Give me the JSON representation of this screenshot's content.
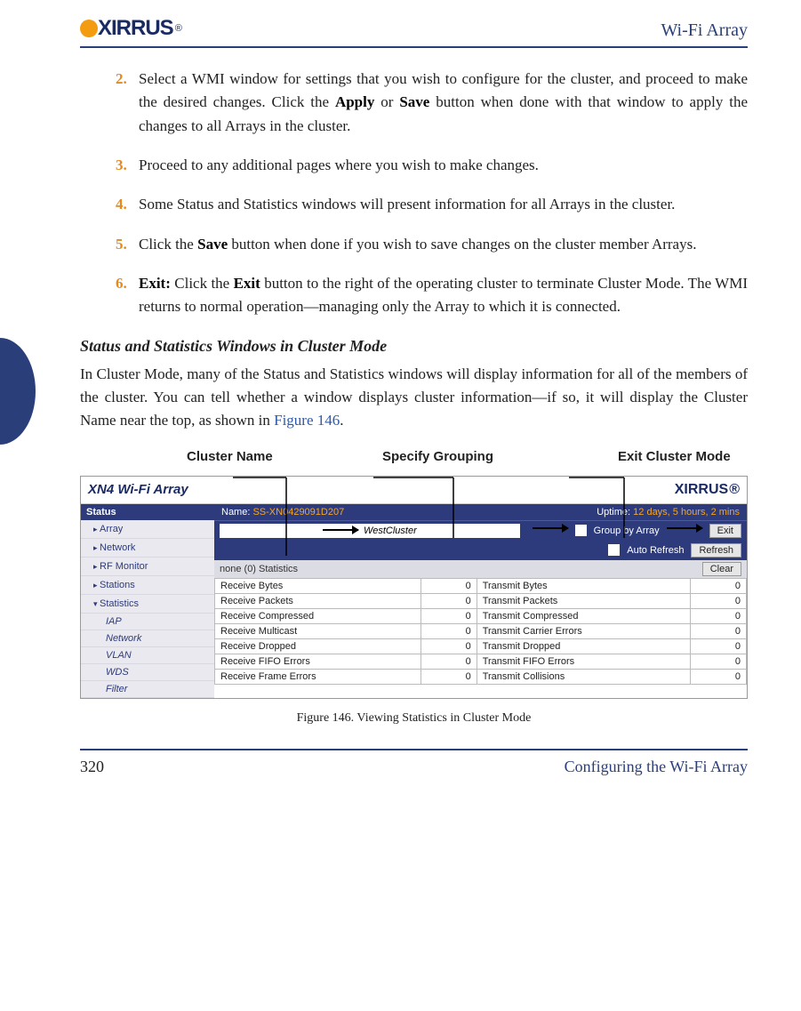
{
  "header": {
    "logo_text": "XIRRUS",
    "title": "Wi-Fi Array"
  },
  "steps": [
    {
      "num": "2.",
      "html": "Select a WMI window for settings that you wish to configure for the cluster, and proceed to make the desired changes. Click the <b>Apply</b> or <b>Save</b> button when done with that window to apply the changes to all Arrays in the cluster."
    },
    {
      "num": "3.",
      "html": "Proceed to any additional pages where you wish to make changes."
    },
    {
      "num": "4.",
      "html": "Some Status and Statistics windows will present information for all Arrays in the cluster."
    },
    {
      "num": "5.",
      "html": "Click the <b>Save</b> button when done if you wish to save changes on the cluster member Arrays."
    },
    {
      "num": "6.",
      "html": "<b>Exit:</b> Click the <b>Exit</b> button to the right of the operating cluster to terminate Cluster Mode. The WMI returns to normal operation—managing only the Array to which it is connected."
    }
  ],
  "subhead": "Status and Statistics Windows in Cluster Mode",
  "para": "In Cluster Mode, many of the Status and Statistics windows will display information for all of the members of the cluster. You can tell whether a window displays cluster information—if so, it will display the Cluster Name near the top, as shown in ",
  "figref": "Figure 146",
  "para_end": ".",
  "callouts": {
    "c1": "Cluster Name",
    "c2": "Specify Grouping",
    "c3": "Exit Cluster Mode"
  },
  "shot": {
    "title": "XN4 Wi-Fi Array",
    "logo": "XIRRUS",
    "name_label": "Name:",
    "name_value": "SS-XN0429091D207",
    "uptime_label": "Uptime:",
    "uptime_value": "12 days, 5 hours, 2 mins",
    "cluster_name": "WestCluster",
    "group_label": "Group by Array",
    "exit_btn": "Exit",
    "auto_refresh": "Auto Refresh",
    "refresh_btn": "Refresh",
    "clear_btn": "Clear",
    "stats_title": "none (0) Statistics",
    "sidebar": {
      "head": "Status",
      "items": [
        "Array",
        "Network",
        "RF Monitor",
        "Stations"
      ],
      "expanded": "Statistics",
      "subs": [
        "IAP",
        "Network",
        "VLAN",
        "WDS",
        "Filter"
      ]
    },
    "rows": [
      [
        "Receive Bytes",
        "0",
        "Transmit Bytes",
        "0"
      ],
      [
        "Receive Packets",
        "0",
        "Transmit Packets",
        "0"
      ],
      [
        "Receive Compressed",
        "0",
        "Transmit Compressed",
        "0"
      ],
      [
        "Receive Multicast",
        "0",
        "Transmit Carrier Errors",
        "0"
      ],
      [
        "Receive Dropped",
        "0",
        "Transmit Dropped",
        "0"
      ],
      [
        "Receive FIFO Errors",
        "0",
        "Transmit FIFO Errors",
        "0"
      ],
      [
        "Receive Frame Errors",
        "0",
        "Transmit Collisions",
        "0"
      ]
    ]
  },
  "caption": "Figure 146. Viewing Statistics in Cluster Mode",
  "footer": {
    "page": "320",
    "section": "Configuring the Wi-Fi Array"
  }
}
